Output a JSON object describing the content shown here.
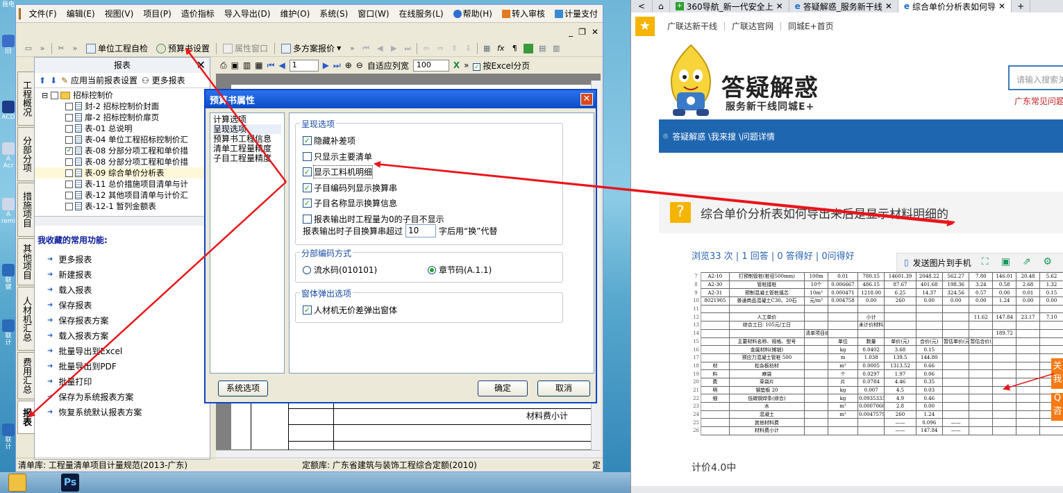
{
  "desktop": {
    "icons": [
      "我电",
      "回",
      "ACD",
      "A\nAcr",
      "A\nremi",
      "联\n键",
      "联\n计",
      "联\n计"
    ],
    "taskbar": [
      "Ps"
    ]
  },
  "app": {
    "menus": [
      "文件(F)",
      "编辑(E)",
      "视图(V)",
      "项目(P)",
      "造价指标",
      "导入导出(D)",
      "维护(O)",
      "系统(S)",
      "窗口(W)",
      "在线服务(L)",
      "帮助(H)",
      "转入审核",
      "计量支付"
    ],
    "doc_controls": [
      "_",
      "❐",
      "✕"
    ],
    "toolbar": {
      "unit_check": "单位工程自检",
      "budget_settings": "预算书设置",
      "property_window": "属性窗口",
      "multi_plan": "多方案报价"
    },
    "vtabs": [
      "工程概况",
      "分部分项",
      "措施项目",
      "其他项目",
      "人材机汇总",
      "费用汇总",
      "报表"
    ],
    "report_panel": {
      "title": "报表",
      "apply_current": "应用当前报表设置",
      "more_reports": "更多报表",
      "tree": [
        {
          "label": "招标控制价",
          "level": 0,
          "checked": false
        },
        {
          "label": "封-2 招标控制价封面",
          "level": 1,
          "checked": false
        },
        {
          "label": "扉-2 招标控制价扉页",
          "level": 1,
          "checked": false
        },
        {
          "label": "表-01 总说明",
          "level": 1,
          "checked": false
        },
        {
          "label": "表-04 单位工程招标控制价汇",
          "level": 1,
          "checked": false
        },
        {
          "label": "表-08 分部分项工程和单价措",
          "level": 1,
          "checked": true
        },
        {
          "label": "表-08 分部分项工程和单价措",
          "level": 1,
          "checked": false
        },
        {
          "label": "表-09 综合单价分析表",
          "level": 1,
          "checked": false
        },
        {
          "label": "表-11 总价措施项目清单与计",
          "level": 1,
          "checked": false
        },
        {
          "label": "表-12 其他项目清单与计价汇",
          "level": 1,
          "checked": false
        },
        {
          "label": "表-12-1 暂列金额表",
          "level": 1,
          "checked": false
        }
      ],
      "favorites_title": "我收藏的常用功能:",
      "favorites": [
        "更多报表",
        "新建报表",
        "载入报表",
        "保存报表",
        "保存报表方案",
        "载入报表方案",
        "批量导出到Excel",
        "批量导出到PDF",
        "批量打印",
        "保存为系统报表方案",
        "恢复系统默认报表方案"
      ]
    },
    "doc_toolbar": {
      "page": "1",
      "fit_width": "自适应列宽",
      "zoom": "100",
      "excel_paging": "按Excel分页"
    },
    "paper_text": "材料费小计",
    "status": {
      "list_lib": "清单库: 工程量清单项目计量规范(2013-广东)",
      "quota_lib": "定额库: 广东省建筑与装饰工程综合定额(2010)",
      "tail": "定"
    }
  },
  "dialog": {
    "title": "预算书属性",
    "left_items": [
      "计算选项",
      "呈现选项",
      "预算书工程信息",
      "清单工程量精度",
      "子目工程量精度"
    ],
    "group1": {
      "title": "呈现选项",
      "options": [
        {
          "label": "隐藏补差项",
          "checked": true
        },
        {
          "label": "只显示主要清单",
          "checked": false
        },
        {
          "label": "显示工料机明细",
          "checked": true
        },
        {
          "label": "子目编码列显示换算串",
          "checked": true
        },
        {
          "label": "子目名称显示换算信息",
          "checked": true
        },
        {
          "label": "报表输出时工程量为0的子目不显示",
          "checked": false
        }
      ],
      "exceed_prefix": "报表输出时子目换算串超过",
      "exceed_value": "10",
      "exceed_suffix": "字后用“换”代替"
    },
    "group2": {
      "title": "分部编码方式",
      "radio1": "流水码(010101)",
      "radio2": "章节码(A.1.1)",
      "selected": "章节码(A.1.1)"
    },
    "group3": {
      "title": "窗体弹出选项",
      "option": {
        "label": "人材机无价差弹出窗体",
        "checked": true
      }
    },
    "buttons": {
      "system": "系统选项",
      "ok": "确定",
      "cancel": "取消"
    }
  },
  "browser": {
    "tabs": [
      "360导航_新一代安全上",
      "答疑解惑_服务新干线",
      "综合单价分析表如何导"
    ],
    "favorites": [
      "广联达新干线",
      "广联达官网",
      "同城E+首页"
    ],
    "logo_title": "答疑解惑",
    "logo_subtitle": "服务新干线同城E+",
    "search_placeholder": "请输入搜索关",
    "faq_link": "广东常见问题",
    "breadcrumb": "答疑解惑 \\我来搜 \\问题详情",
    "question": "综合单价分析表如何导出来后是显示材料明细的",
    "meta": "浏览33 次 | 1 回答 | 0 答得好 | 0问得好",
    "send_to_phone": "发送图片到手机",
    "footer": "计价4.0中",
    "side_float": [
      "关\n我",
      "Q\n咨"
    ]
  },
  "shot_table": {
    "rows": [
      [
        "7",
        "A2-10",
        "打预制管桩(桩径500mm)",
        "100m",
        "0.01",
        "780.15",
        "14601.39",
        "2048.22",
        "562.27",
        "7.80",
        "146.01",
        "20.48",
        "5.62"
      ],
      [
        "8",
        "A2-30",
        "管桩接桩",
        "10个",
        "0.006667",
        "486.15",
        "87.67",
        "401.68",
        "198.36",
        "3.24",
        "0.58",
        "2.68",
        "1.32"
      ],
      [
        "9",
        "A2-31",
        "预制混凝土管桩填芯",
        "10m³",
        "0.000471",
        "1218.00",
        "6.25",
        "14.37",
        "324.56",
        "0.57",
        "0.00",
        "0.01",
        "0.15"
      ],
      [
        "10",
        "8021905",
        "普通商品混凝土C30、20石",
        "元/m³",
        "0.004758",
        "0.00",
        "260",
        "0.00",
        "0.00",
        "0.00",
        "1.24",
        "0.00",
        "0.00"
      ],
      [
        "11",
        "",
        "",
        "",
        "",
        "",
        "",
        "",
        "",
        "",
        "",
        "",
        ""
      ],
      [
        "12",
        "",
        "人工单价",
        "",
        "",
        "小计",
        "",
        "",
        "",
        "11.62",
        "147.84",
        "23.17",
        "7.10"
      ],
      [
        "13",
        "",
        "综合工日: 105元/工日",
        "",
        "",
        "未计价材料费",
        "",
        "",
        "",
        "",
        "",
        "",
        ""
      ],
      [
        "14",
        "",
        "",
        "清单项目综合单价",
        "",
        "",
        "",
        "",
        "",
        "",
        "189.72",
        "",
        ""
      ],
      [
        "15",
        "",
        "主要材料名称、规格、型号",
        "",
        "单位",
        "数量",
        "单价(元)",
        "合价(元)",
        "暂估单价(元)",
        "暂估合价(元)",
        "",
        "",
        ""
      ],
      [
        "16",
        "",
        "金属材料(摊销)",
        "",
        "kg",
        "0.0402",
        "3.68",
        "0.15",
        "",
        "",
        "",
        "",
        ""
      ],
      [
        "17",
        "",
        "预应力混凝土管桩 500",
        "",
        "m",
        "1.038",
        "139.5",
        "144.80",
        "",
        "",
        "",
        "",
        ""
      ],
      [
        "18",
        "材",
        "松杂板枋材",
        "",
        "m³",
        "0.0005",
        "1313.52",
        "0.66",
        "",
        "",
        "",
        "",
        ""
      ],
      [
        "19",
        "料",
        "麻袋",
        "",
        "个",
        "0.0297",
        "1.97",
        "0.06",
        "",
        "",
        "",
        "",
        ""
      ],
      [
        "20",
        "费",
        "草袋片",
        "",
        "片",
        "0.0784",
        "4.46",
        "0.35",
        "",
        "",
        "",
        "",
        ""
      ],
      [
        "21",
        "明",
        "钢垫板 20",
        "",
        "kg",
        "0.007",
        "4.5",
        "0.03",
        "",
        "",
        "",
        "",
        ""
      ],
      [
        "22",
        "细",
        "低碳钢焊条(综合)",
        "",
        "kg",
        "0.0935333",
        "4.9",
        "0.46",
        "",
        "",
        "",
        "",
        ""
      ],
      [
        "23",
        "",
        "水",
        "",
        "m³",
        "0.0007066",
        "2.8",
        "0.00",
        "",
        "",
        "",
        "",
        ""
      ],
      [
        "24",
        "",
        "混凝土",
        "",
        "m³",
        "0.0047579",
        "260",
        "1.24",
        "",
        "",
        "",
        "",
        ""
      ],
      [
        "25",
        "",
        "其他材料费",
        "",
        "",
        "",
        "——",
        "0.096",
        "——",
        "",
        "",
        "",
        ""
      ],
      [
        "26",
        "",
        "材料费小计",
        "",
        "",
        "",
        "——",
        "147.84",
        "——",
        "",
        "",
        "",
        ""
      ]
    ]
  },
  "colors": {
    "annotation": "#e8151b",
    "dialog_title": "#0a4cc6",
    "browser_nav": "#1e66b0",
    "accent_yellow": "#f5b400"
  }
}
